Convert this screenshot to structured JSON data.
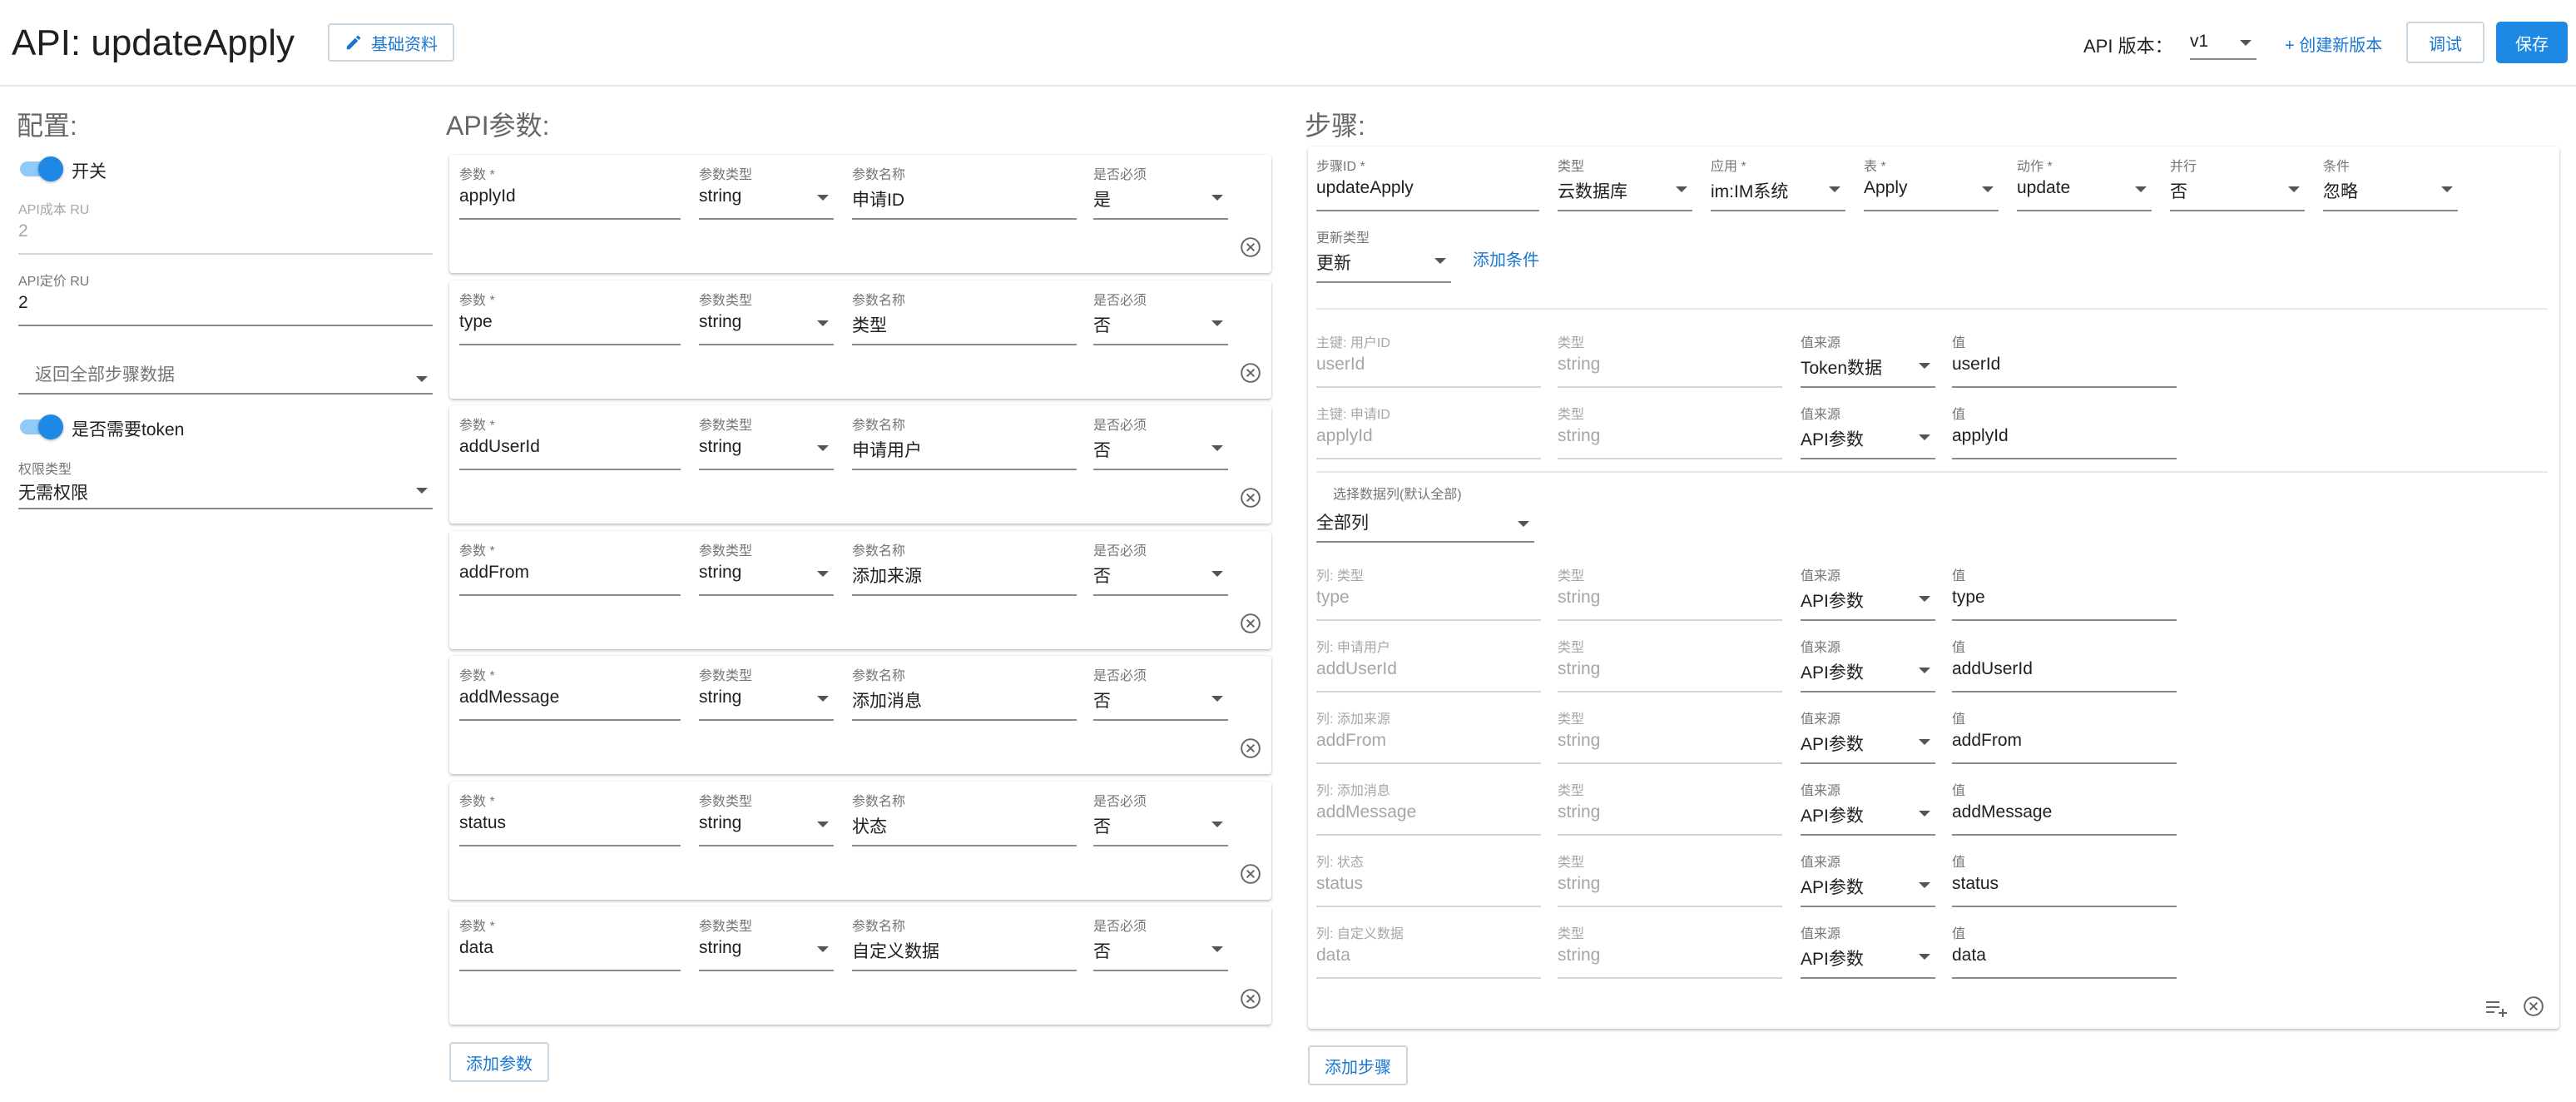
{
  "header": {
    "title": "API: updateApply",
    "basic_info_label": "基础资料",
    "version_label": "API 版本：",
    "version_value": "v1",
    "create_version_label": "+ 创建新版本",
    "debug_label": "调试",
    "save_label": "保存"
  },
  "config": {
    "title": "配置:",
    "switch_label": "开关",
    "cost_label": "API成本 RU",
    "cost_value": "2",
    "price_label": "API定价 RU",
    "price_value": "2",
    "return_placeholder": "返回全部步骤数据",
    "token_label": "是否需要token",
    "perm_label": "权限类型",
    "perm_value": "无需权限"
  },
  "params": {
    "title": "API参数:",
    "labels": {
      "param": "参数 *",
      "type": "参数类型",
      "name": "参数名称",
      "required": "是否必须"
    },
    "rows": [
      {
        "param": "applyId",
        "type": "string",
        "name": "申请ID",
        "required": "是"
      },
      {
        "param": "type",
        "type": "string",
        "name": "类型",
        "required": "否"
      },
      {
        "param": "addUserId",
        "type": "string",
        "name": "申请用户",
        "required": "否"
      },
      {
        "param": "addFrom",
        "type": "string",
        "name": "添加来源",
        "required": "否"
      },
      {
        "param": "addMessage",
        "type": "string",
        "name": "添加消息",
        "required": "否"
      },
      {
        "param": "status",
        "type": "string",
        "name": "状态",
        "required": "否"
      },
      {
        "param": "data",
        "type": "string",
        "name": "自定义数据",
        "required": "否"
      }
    ],
    "add_label": "添加参数"
  },
  "steps": {
    "title": "步骤:",
    "step_id_label": "步骤ID *",
    "step_id_value": "updateApply",
    "kind_label": "类型",
    "kind_value": "云数据库",
    "app_label": "应用 *",
    "app_value": "im:IM系统",
    "table_label": "表 *",
    "table_value": "Apply",
    "action_label": "动作 *",
    "action_value": "update",
    "parallel_label": "并行",
    "parallel_value": "否",
    "condition_label": "条件",
    "condition_value": "忽略",
    "update_type_label": "更新类型",
    "update_type_value": "更新",
    "add_condition_label": "添加条件",
    "key_type_label": "类型",
    "key_src_label": "值来源",
    "key_val_label": "值",
    "keys": [
      {
        "label": "主键: 用户ID",
        "field": "userId",
        "type": "string",
        "source": "Token数据",
        "value": "userId"
      },
      {
        "label": "主键: 申请ID",
        "field": "applyId",
        "type": "string",
        "source": "API参数",
        "value": "applyId"
      }
    ],
    "columns_select_label": "选择数据列(默认全部)",
    "columns_select_value": "全部列",
    "columns": [
      {
        "label": "列: 类型",
        "field": "type",
        "type": "string",
        "source": "API参数",
        "value": "type"
      },
      {
        "label": "列: 申请用户",
        "field": "addUserId",
        "type": "string",
        "source": "API参数",
        "value": "addUserId"
      },
      {
        "label": "列: 添加来源",
        "field": "addFrom",
        "type": "string",
        "source": "API参数",
        "value": "addFrom"
      },
      {
        "label": "列: 添加消息",
        "field": "addMessage",
        "type": "string",
        "source": "API参数",
        "value": "addMessage"
      },
      {
        "label": "列: 状态",
        "field": "status",
        "type": "string",
        "source": "API参数",
        "value": "status"
      },
      {
        "label": "列: 自定义数据",
        "field": "data",
        "type": "string",
        "source": "API参数",
        "value": "data"
      }
    ],
    "add_step_label": "添加步骤"
  }
}
